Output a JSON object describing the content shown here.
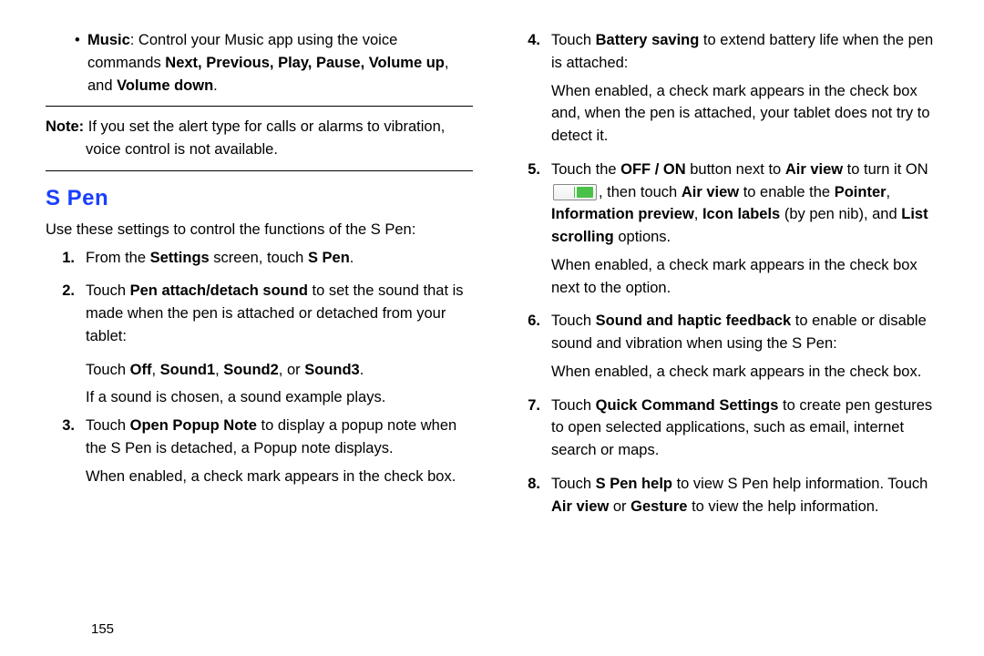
{
  "left": {
    "music_bullet": {
      "lead": "Music",
      "rest": ": Control your Music app using the voice commands ",
      "bold_list": "Next, Previous, Play, Pause, Volume up",
      "between": ", and ",
      "last_bold": "Volume down",
      "period": "."
    },
    "note_label": "Note:",
    "note_text": " If you set the alert type for calls or alarms to vibration, voice control is not available.",
    "heading": "S Pen",
    "intro": "Use these settings to control the functions of the S Pen:",
    "steps": {
      "s1_num": "1.",
      "s1_a": "From the ",
      "s1_b": "Settings",
      "s1_c": " screen, touch ",
      "s1_d": "S Pen",
      "s1_e": ".",
      "s2_num": "2.",
      "s2_a": "Touch ",
      "s2_b": "Pen attach/detach sound",
      "s2_c": " to set the sound that is made when the pen is attached or detached from your tablet:",
      "s2_sub1_a": "Touch ",
      "s2_sub1_b": "Off",
      "s2_sub1_c": ", ",
      "s2_sub1_d": "Sound1",
      "s2_sub1_e": ", ",
      "s2_sub1_f": "Sound2",
      "s2_sub1_g": ", or ",
      "s2_sub1_h": "Sound3",
      "s2_sub1_i": ".",
      "s2_sub2": "If a sound is chosen, a sound example plays.",
      "s3_num": "3.",
      "s3_a": "Touch ",
      "s3_b": "Open Popup Note",
      "s3_c": " to display a popup note when the S Pen is detached, a Popup note displays.",
      "s3_sub": "When enabled, a check mark appears in the check box."
    }
  },
  "right": {
    "steps": {
      "s4_num": "4.",
      "s4_a": "Touch ",
      "s4_b": "Battery saving",
      "s4_c": " to extend battery life when the pen is attached:",
      "s4_sub": "When enabled, a check mark appears in the check box and, when the pen is attached, your tablet does not try to detect it.",
      "s5_num": "5.",
      "s5_a": "Touch the ",
      "s5_b": "OFF / ON",
      "s5_c": " button next to ",
      "s5_d": "Air view",
      "s5_e": " to turn it ON ",
      "s5_f": ", then touch ",
      "s5_g": "Air view",
      "s5_h": " to enable the ",
      "s5_i": "Pointer",
      "s5_j": ", ",
      "s5_k": "Information preview",
      "s5_l": ", ",
      "s5_m": "Icon labels",
      "s5_n": " (by pen nib), and ",
      "s5_o": "List scrolling",
      "s5_p": " options.",
      "s5_sub": "When enabled, a check mark appears in the check box next to the option.",
      "s6_num": "6.",
      "s6_a": "Touch ",
      "s6_b": "Sound and haptic feedback",
      "s6_c": " to enable or disable sound and vibration when using the S Pen:",
      "s6_sub": "When enabled, a check mark appears in the check box.",
      "s7_num": "7.",
      "s7_a": "Touch ",
      "s7_b": "Quick Command Settings",
      "s7_c": " to create pen gestures to open selected applications, such as email, internet search or maps.",
      "s8_num": "8.",
      "s8_a": "Touch ",
      "s8_b": "S Pen help",
      "s8_c": " to view S Pen help information. Touch ",
      "s8_d": "Air view",
      "s8_e": " or ",
      "s8_f": "Gesture",
      "s8_g": " to view the help information."
    }
  },
  "page_number": "155"
}
